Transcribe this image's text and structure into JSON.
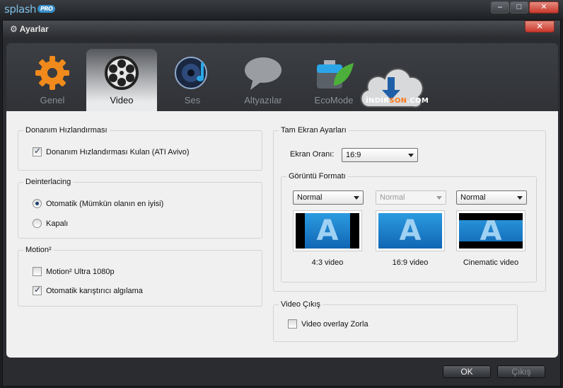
{
  "app": {
    "logo_text": "splash",
    "logo_badge": "PRO",
    "window_controls": {
      "minimize": "–",
      "maximize": "□",
      "close": "✕"
    }
  },
  "dialog": {
    "title": "Ayarlar",
    "title_icon": "gear-icon",
    "close_symbol": "✕"
  },
  "tabs": [
    {
      "id": "genel",
      "label": "Genel",
      "icon": "gear-icon",
      "active": false
    },
    {
      "id": "video",
      "label": "Video",
      "icon": "film-reel-icon",
      "active": true
    },
    {
      "id": "ses",
      "label": "Ses",
      "icon": "speaker-icon",
      "active": false
    },
    {
      "id": "altyazilar",
      "label": "Altyazılar",
      "icon": "speech-bubble-icon",
      "active": false
    },
    {
      "id": "ecomode",
      "label": "EcoMode",
      "icon": "battery-leaf-icon",
      "active": false
    }
  ],
  "watermark": {
    "text_part1": "İNDİR",
    "text_part2": "SON",
    "text_part3": ".COM"
  },
  "hardware": {
    "title": "Donanım Hızlandırması",
    "checkbox_label": "Donanım Hızlandırması Kulan  (ATI Avivo)",
    "checked": true
  },
  "deinterlacing": {
    "title": "Deinterlacing",
    "options": [
      {
        "label": "Otomatik (Mümkün olanın en iyisi)",
        "selected": true
      },
      {
        "label": "Kapalı",
        "selected": false
      }
    ]
  },
  "motion": {
    "title": "Motion²",
    "options": [
      {
        "label": "Motion² Ultra 1080p",
        "checked": false
      },
      {
        "label": "Otomatik karıştırıcı algılama",
        "checked": true
      }
    ]
  },
  "fullscreen": {
    "title": "Tam Ekran Ayarları",
    "ratio_label": "Ekran Oranı:",
    "ratio_value": "16:9",
    "format": {
      "title": "Görüntü Formatı",
      "items": [
        {
          "select": "Normal",
          "enabled": true,
          "caption": "4:3 video"
        },
        {
          "select": "Normal",
          "enabled": false,
          "caption": "16:9 video"
        },
        {
          "select": "Normal",
          "enabled": true,
          "caption": "Cinematic video"
        }
      ],
      "thumb_letter": "A"
    }
  },
  "video_out": {
    "title": "Video Çıkış",
    "checkbox_label": "Video overlay Zorla",
    "checked": false
  },
  "footer": {
    "ok": "OK",
    "exit": "Çıkış"
  },
  "colors": {
    "accent_blue": "#2b9be0",
    "close_red": "#c9382b",
    "panel_bg": "#f0f0f0"
  }
}
